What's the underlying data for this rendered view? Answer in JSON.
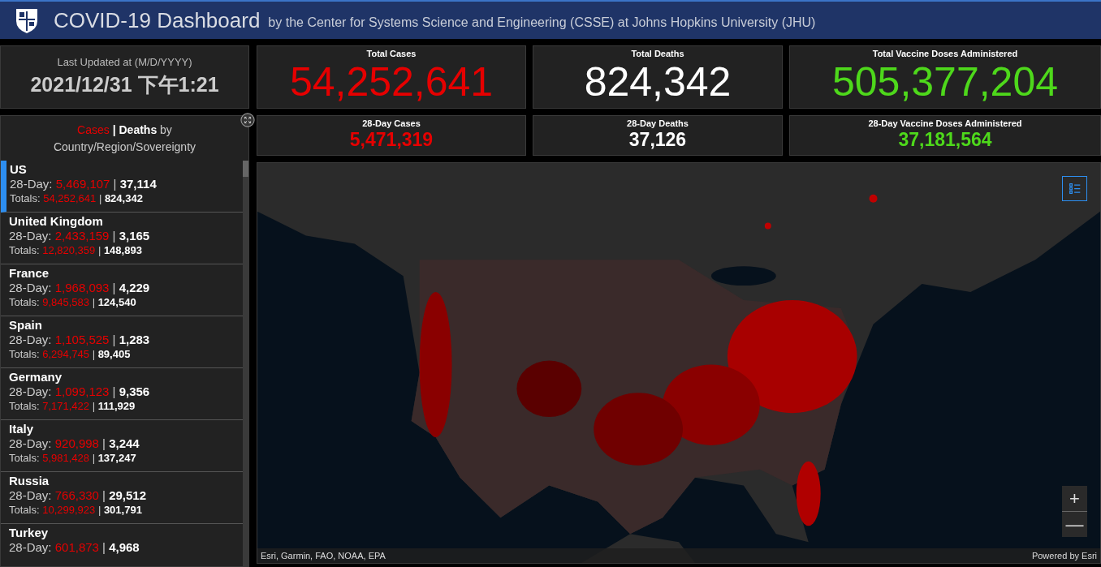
{
  "header": {
    "title": "COVID-19 Dashboard",
    "subtitle": "by the Center for Systems Science and Engineering (CSSE) at Johns Hopkins University (JHU)"
  },
  "last_updated": {
    "label": "Last Updated at (M/D/YYYY)",
    "value": "2021/12/31 下午1:21"
  },
  "totals": [
    {
      "label": "Total Cases",
      "value": "54,252,641",
      "kind": "cases"
    },
    {
      "label": "Total Deaths",
      "value": "824,342",
      "kind": "deaths"
    },
    {
      "label": "Total Vaccine Doses Administered",
      "value": "505,377,204",
      "kind": "vaccine"
    }
  ],
  "day28": [
    {
      "label": "28-Day Cases",
      "value": "5,471,319",
      "kind": "cases"
    },
    {
      "label": "28-Day Deaths",
      "value": "37,126",
      "kind": "deaths"
    },
    {
      "label": "28-Day Vaccine Doses Administered",
      "value": "37,181,564",
      "kind": "vaccine"
    }
  ],
  "country_list": {
    "title_cases": "Cases",
    "separator": "|",
    "title_deaths": "Deaths",
    "title_rest": "by Country/Region/Sovereignty",
    "items": [
      {
        "name": "US",
        "day_label": "28-Day:",
        "day_cases": "5,469,107",
        "day_sep": "|",
        "day_deaths": "37,114",
        "total_label": "Totals:",
        "total_cases": "54,252,641",
        "total_sep": "|",
        "total_deaths": "824,342",
        "selected": true
      },
      {
        "name": "United Kingdom",
        "day_label": "28-Day:",
        "day_cases": "2,433,159",
        "day_sep": "|",
        "day_deaths": "3,165",
        "total_label": "Totals:",
        "total_cases": "12,820,359",
        "total_sep": "|",
        "total_deaths": "148,893",
        "selected": false
      },
      {
        "name": "France",
        "day_label": "28-Day:",
        "day_cases": "1,968,093",
        "day_sep": "|",
        "day_deaths": "4,229",
        "total_label": "Totals:",
        "total_cases": "9,845,583",
        "total_sep": "|",
        "total_deaths": "124,540",
        "selected": false
      },
      {
        "name": "Spain",
        "day_label": "28-Day:",
        "day_cases": "1,105,525",
        "day_sep": "|",
        "day_deaths": "1,283",
        "total_label": "Totals:",
        "total_cases": "6,294,745",
        "total_sep": "|",
        "total_deaths": "89,405",
        "selected": false
      },
      {
        "name": "Germany",
        "day_label": "28-Day:",
        "day_cases": "1,099,123",
        "day_sep": "|",
        "day_deaths": "9,356",
        "total_label": "Totals:",
        "total_cases": "7,171,422",
        "total_sep": "|",
        "total_deaths": "111,929",
        "selected": false
      },
      {
        "name": "Italy",
        "day_label": "28-Day:",
        "day_cases": "920,998",
        "day_sep": "|",
        "day_deaths": "3,244",
        "total_label": "Totals:",
        "total_cases": "5,981,428",
        "total_sep": "|",
        "total_deaths": "137,247",
        "selected": false
      },
      {
        "name": "Russia",
        "day_label": "28-Day:",
        "day_cases": "766,330",
        "day_sep": "|",
        "day_deaths": "29,512",
        "total_label": "Totals:",
        "total_cases": "10,299,923",
        "total_sep": "|",
        "total_deaths": "301,791",
        "selected": false
      },
      {
        "name": "Turkey",
        "day_label": "28-Day:",
        "day_cases": "601,873",
        "day_sep": "|",
        "day_deaths": "4,968",
        "selected": false
      }
    ]
  },
  "map": {
    "kind": "picture",
    "attribution": "Esri, Garmin, FAO, NOAA, EPA",
    "powered_by": "Powered by Esri",
    "zoom_in": "+",
    "zoom_out": "—"
  }
}
